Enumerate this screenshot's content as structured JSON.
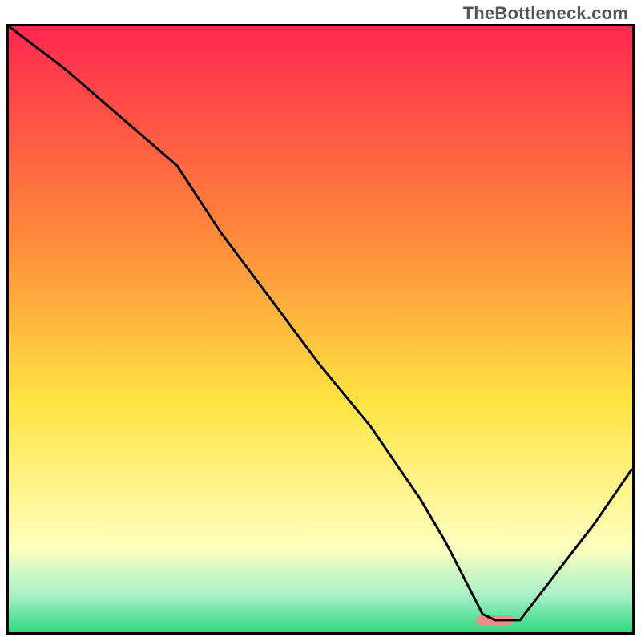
{
  "watermark": "TheBottleneck.com",
  "colors": {
    "border": "#000000",
    "curve": "#000000",
    "marker": "#f08b8f",
    "gradient_top": "#ff2850",
    "gradient_mid_orange": "#ff8a3a",
    "gradient_mid_yellow": "#ffe442",
    "gradient_pale_yellow": "#ffffbe",
    "gradient_green": "#2dd97f",
    "gradient_mint": "#a5f0c8"
  },
  "chart_data": {
    "type": "line",
    "title": "",
    "xlabel": "",
    "ylabel": "",
    "xlim": [
      0,
      100
    ],
    "ylim": [
      0,
      100
    ],
    "curve": {
      "x": [
        0,
        9,
        18,
        27,
        34,
        42,
        50,
        58,
        66,
        70,
        74,
        76,
        78,
        82,
        88,
        94,
        100
      ],
      "y": [
        100,
        93,
        85,
        77,
        66,
        55,
        44,
        34,
        22,
        15,
        7,
        3,
        2,
        2,
        10,
        18,
        27
      ]
    },
    "marker": {
      "x_center": 78,
      "x_width": 6,
      "y": 2
    },
    "annotations": []
  }
}
